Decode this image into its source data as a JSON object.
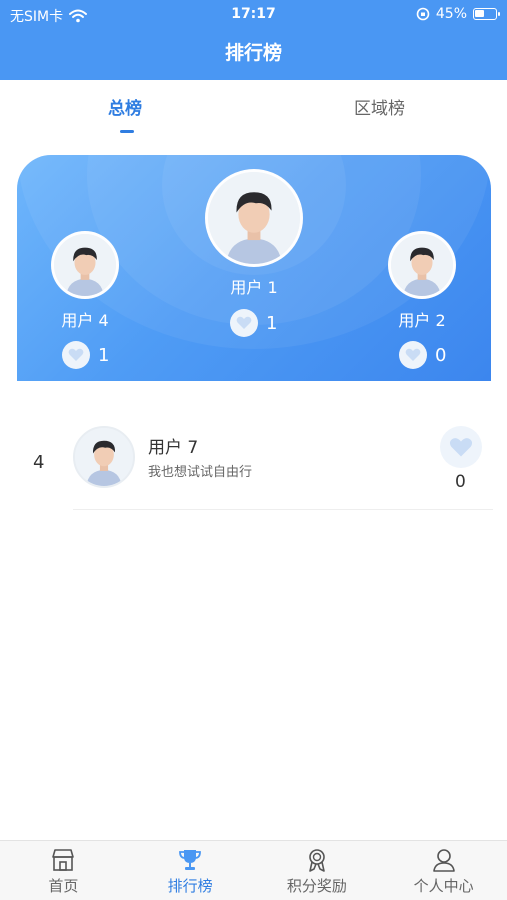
{
  "status": {
    "carrier": "无SIM卡",
    "time": "17:17",
    "battery": "45%"
  },
  "header": {
    "title": "排行榜"
  },
  "tabs": [
    {
      "label": "总榜",
      "active": true
    },
    {
      "label": "区域榜",
      "active": false
    }
  ],
  "podium": {
    "first": {
      "name": "用户 1",
      "likes": "1"
    },
    "second": {
      "name": "用户 2",
      "likes": "0"
    },
    "third": {
      "name": "用户 4",
      "likes": "1"
    }
  },
  "list": [
    {
      "rank": "4",
      "name": "用户 7",
      "subtitle": "我也想试试自由行",
      "likes": "0"
    }
  ],
  "nav": [
    {
      "label": "首页",
      "icon": "home-icon",
      "active": false
    },
    {
      "label": "排行榜",
      "icon": "trophy-icon",
      "active": true
    },
    {
      "label": "积分奖励",
      "icon": "medal-icon",
      "active": false
    },
    {
      "label": "个人中心",
      "icon": "person-icon",
      "active": false
    }
  ],
  "colors": {
    "primary": "#4a97f3",
    "active_text": "#2f7de1",
    "heart": "#c9dcf5"
  }
}
